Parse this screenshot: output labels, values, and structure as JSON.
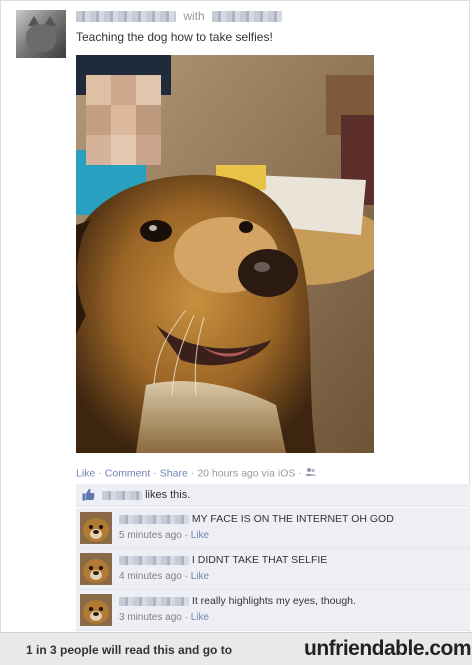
{
  "post": {
    "with_label": "with",
    "status_text": "Teaching the dog how to take selfies!",
    "photo_alt": "Dog selfie photo"
  },
  "actions": {
    "like": "Like",
    "comment": "Comment",
    "share": "Share",
    "timestamp": "20 hours ago via iOS"
  },
  "likes": {
    "text": "likes this."
  },
  "comments": [
    {
      "text": "MY FACE IS ON THE INTERNET OH GOD",
      "time": "5 minutes ago",
      "like": "Like"
    },
    {
      "text": "I DIDNT TAKE THAT SELFIE",
      "time": "4 minutes ago",
      "like": "Like"
    },
    {
      "text": "It really highlights my eyes, though.",
      "time": "3 minutes ago",
      "like": "Like"
    }
  ],
  "footer": {
    "cta": "1 in 3 people will read this and go to",
    "brand": "unfriendable.com"
  },
  "colors": {
    "link": "#3b5998",
    "action_link": "#6d84b4",
    "comment_bg": "#edeff4"
  }
}
